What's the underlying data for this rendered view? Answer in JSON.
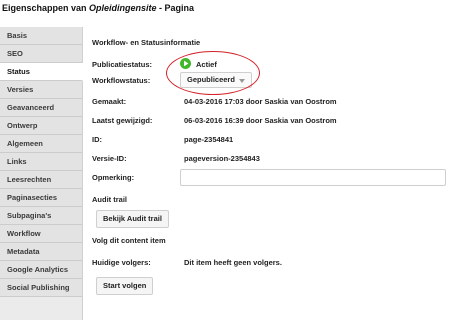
{
  "window": {
    "title_prefix": "Eigenschappen van ",
    "title_site": "Opleidingensite",
    "title_suffix": " - Pagina"
  },
  "sidebar": {
    "items": [
      {
        "label": "Basis"
      },
      {
        "label": "SEO"
      },
      {
        "label": "Status",
        "active": true
      },
      {
        "label": "Versies"
      },
      {
        "label": "Geavanceerd"
      },
      {
        "label": "Ontwerp"
      },
      {
        "label": "Algemeen"
      },
      {
        "label": "Links"
      },
      {
        "label": "Leesrechten"
      },
      {
        "label": "Paginasecties"
      },
      {
        "label": "Subpagina's"
      },
      {
        "label": "Workflow"
      },
      {
        "label": "Metadata"
      },
      {
        "label": "Google Analytics"
      },
      {
        "label": "Social Publishing"
      }
    ]
  },
  "main": {
    "section_title": "Workflow- en Statusinformatie",
    "publication_status": {
      "label": "Publicatiestatus:",
      "value": "Actief",
      "icon": "play-icon",
      "color": "#42b72a"
    },
    "workflow_status": {
      "label": "Workflowstatus:",
      "selected": "Gepubliceerd"
    },
    "created": {
      "label": "Gemaakt:",
      "value": "04-03-2016 17:03 door Saskia van Oostrom"
    },
    "modified": {
      "label": "Laatst gewijzigd:",
      "value": "06-03-2016 16:39 door Saskia van Oostrom"
    },
    "id": {
      "label": "ID:",
      "value": "page-2354841"
    },
    "version_id": {
      "label": "Versie-ID:",
      "value": "pageversion-2354843"
    },
    "remark": {
      "label": "Opmerking:",
      "value": ""
    },
    "audit_trail": {
      "heading": "Audit trail",
      "button": "Bekijk Audit trail"
    },
    "follow": {
      "heading": "Volg dit content item",
      "followers_label": "Huidige volgers:",
      "followers_value": "Dit item heeft geen volgers.",
      "button": "Start volgen"
    }
  },
  "colors": {
    "highlight": "#d4212a",
    "sidebar_bg": "#e3e3e3",
    "active_tab_bg": "#ffffff"
  }
}
